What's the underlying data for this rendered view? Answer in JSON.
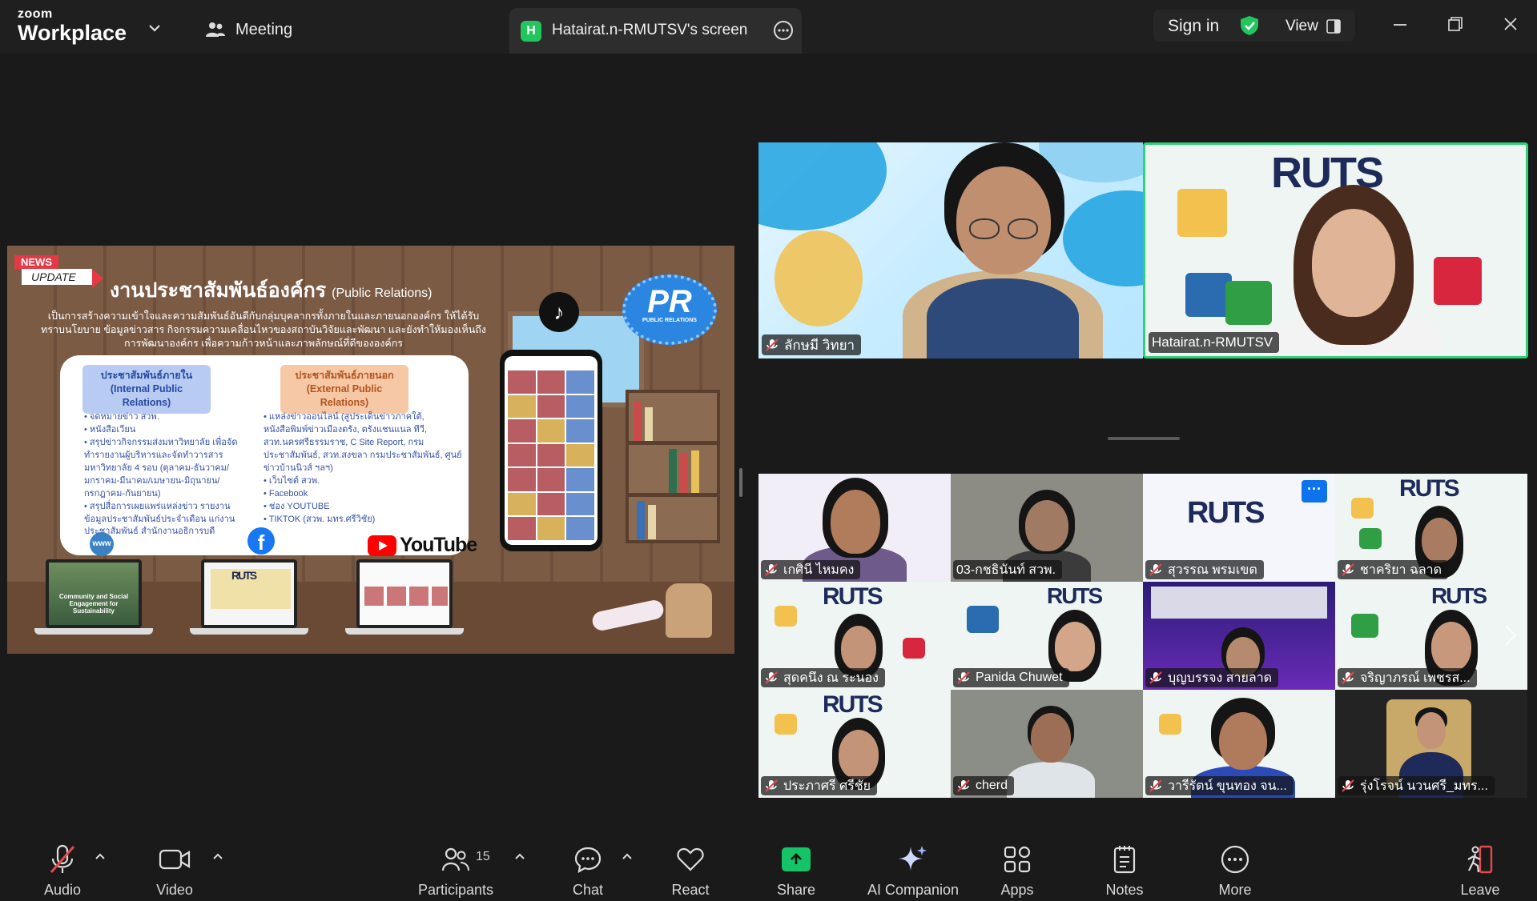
{
  "window": {
    "brand_small": "zoom",
    "brand_big": "Workplace",
    "meeting_label": "Meeting",
    "tab_label": "Hatairat.n-RMUTSV's screen",
    "tab_badge": "H",
    "sign_in": "Sign in",
    "view_label": "View"
  },
  "colors": {
    "accent_green": "#22c55e",
    "share_green": "#14c466",
    "active_speaker_border": "#2fd27a",
    "toolbar_bg": "#1a1a1a",
    "mute_red": "#e5484d"
  },
  "slide": {
    "news": "NEWS",
    "update": "UPDATE",
    "title": "งานประชาสัมพันธ์องค์กร",
    "title_en": "(Public Relations)",
    "intro": "เป็นการสร้างความเข้าใจและความสัมพันธ์อันดีกับกลุ่มบุคลากรทั้งภายในและภายนอกองค์กร ให้ได้รับทราบนโยบาย ข้อมูลข่าวสาร กิจกรรมความเคลื่อนไหวของสถาบันวิจัยและพัฒนา และยังทำให้มองเห็นถึงการพัฒนาองค์กร เพื่อความก้าวหน้าและภาพลักษณ์ที่ดีขององค์กร",
    "internal_head": "ประชาสัมพันธ์ภายใน",
    "internal_head_en": "(Internal Public Relations)",
    "internal_items": [
      "จดหมายข่าว สวพ.",
      "หนังสือเวียน",
      "สรุปข่าวกิจกรรมส่งมหาวิทยาลัย เพื่อจัดทำรายงานผู้บริหารและจัดทำวารสารมหาวิทยาลัย 4 รอบ (ตุลาคม-ธันวาคม/มกราคม-มีนาคม/เมษายน-มิถุนายน/กรกฎาคม-กันยายน)",
      "สรุปสื่อการเผยแพร่แหล่งข่าว รายงานข้อมูลประชาสัมพันธ์ประจำเดือน แก่งานประชาสัมพันธ์ สำนักงานอธิการบดี"
    ],
    "external_head": "ประชาสัมพันธ์ภายนอก",
    "external_head_en": "(External Public Relations)",
    "external_items": [
      "แหล่งข่าวออนไลน์ (สูประเด็นข่าวภาคใต้, หนังสือพิมพ์ข่าวเมืองตรัง, ตรังแชนแนล ทีวี, สวท.นครศรีธรรมราช, C Site Report, กรมประชาสัมพันธ์, สวท.สงขลา กรมประชาสัมพันธ์, ศูนย์ข่าวบ้านนิวส์ ฯลฯ)",
      "เว็บไซต์ สวพ.",
      "Facebook",
      "ช่อง YOUTUBE",
      "TIKTOK (สวพ. มทร.ศรีวิชัย)"
    ],
    "laptop_caption": "Community and Social Engagement for Sustainability",
    "www": "www",
    "youtube": "YouTube",
    "pr_big": "PR",
    "pr_small": "PUBLIC RELATIONS",
    "rut_text": "RUTS"
  },
  "top_participants": [
    {
      "name": "ลักษมี วิทยา",
      "muted": true
    },
    {
      "name": "Hatairat.n-RMUTSV",
      "muted": false,
      "active_speaker": true
    }
  ],
  "gallery": [
    {
      "name": "เกศินี ไหมคง",
      "muted": true
    },
    {
      "name": "03-กชธินันท์ สวพ.",
      "muted": false
    },
    {
      "name": "สุวรรณ พรมเขต",
      "muted": true
    },
    {
      "name": "ชาคริยา ฉลาด",
      "muted": true
    },
    {
      "name": "สุดคนึง ณ ระนอง",
      "muted": true
    },
    {
      "name": "Panida Chuwet",
      "muted": true
    },
    {
      "name": "บุญบรรจง สายลาด",
      "muted": true
    },
    {
      "name": "จริญาภรณ์ เพชรส...",
      "muted": true
    },
    {
      "name": "ประภาศรี ศรีชัย",
      "muted": true
    },
    {
      "name": "cherd",
      "muted": true
    },
    {
      "name": "วารีรัตน์ ขุนทอง จน...",
      "muted": true
    },
    {
      "name": "รุ่งโรจน์ นวนศรี_มทร...",
      "muted": true
    }
  ],
  "gallery_more_badge": "···",
  "toolbar": {
    "audio": "Audio",
    "video": "Video",
    "participants": "Participants",
    "participant_count": "15",
    "chat": "Chat",
    "react": "React",
    "share": "Share",
    "ai_companion": "AI Companion",
    "apps": "Apps",
    "notes": "Notes",
    "more": "More",
    "leave": "Leave"
  },
  "icons": [
    "chevron-down-icon",
    "participants-icon",
    "more-options-icon",
    "shield-check-icon",
    "view-layout-icon",
    "minimize-icon",
    "restore-icon",
    "close-icon",
    "mic-off-icon",
    "video-icon",
    "chat-icon",
    "heart-icon",
    "share-arrow-icon",
    "sparkle-icon",
    "apps-icon",
    "notes-icon",
    "more-icon",
    "leave-icon"
  ]
}
